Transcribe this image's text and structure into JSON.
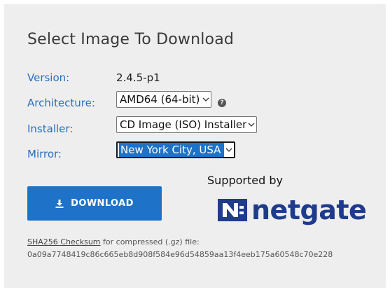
{
  "title": "Select Image To Download",
  "version": {
    "label": "Version:",
    "value": "2.4.5-p1"
  },
  "architecture": {
    "label": "Architecture:",
    "value": "AMD64 (64-bit)"
  },
  "installer": {
    "label": "Installer:",
    "value": "CD Image (ISO) Installer"
  },
  "mirror": {
    "label": "Mirror:",
    "value": "New York City, USA"
  },
  "help_icon": "?",
  "download_button": {
    "label": "DOWNLOAD",
    "icon": "download-icon"
  },
  "supported_by": "Supported by",
  "logo_text": "netgate",
  "checksum": {
    "link": "SHA256 Checksum",
    "text": " for compressed (.gz) file:",
    "hash": "0a09a7748419c86c665eb8d908f584e96d54859aa13f4eeb175a60548c70e228"
  },
  "colors": {
    "accent": "#1e73c8",
    "label": "#2a6ebd",
    "panel": "#eeeeee",
    "logo": "#1f3b8c"
  }
}
